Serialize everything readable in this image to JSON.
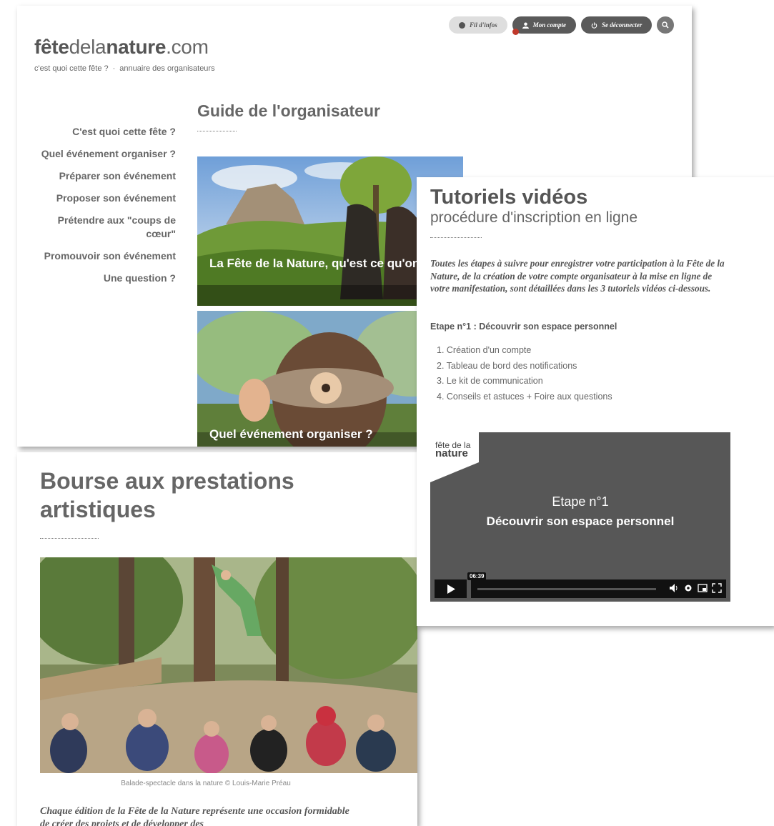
{
  "header": {
    "fil_infos": "Fil d'infos",
    "mon_compte": "Mon compte",
    "deconnecter": "Se déconnecter",
    "logo": {
      "a": "fête",
      "b": "dela",
      "c": "nature",
      "d": ".com"
    },
    "sublinks": [
      "c'est quoi cette fête ?",
      "annuaire des organisateurs"
    ],
    "separator": "·"
  },
  "sidebar": {
    "items": [
      "C'est quoi cette fête ?",
      "Quel événement organiser ?",
      "Préparer son événement",
      "Proposer son événement",
      "Prétendre aux \"coups de cœur\"",
      "Promouvoir son événement",
      "Une question ?"
    ]
  },
  "guide": {
    "title": "Guide de l'organisateur",
    "cards": [
      {
        "title": "La Fête de la Nature, qu'est ce qu'on c'est ?"
      },
      {
        "title": "Quel événement organiser ?"
      }
    ]
  },
  "tutoriels": {
    "title": "Tutoriels vidéos",
    "subtitle": "procédure d'inscription en ligne",
    "intro": "Toutes les étapes à suivre pour enregistrer votre participation à la Fête de la Nature, de la création de votre compte organisateur à la mise en ligne de votre manifestation, sont détaillées dans les 3 tutoriels vidéos ci-dessous.",
    "step": "Etape n°1 : Découvrir son espace personnel",
    "list": [
      "1. Création d'un compte",
      "2. Tableau de bord des notifications",
      "3. Le kit de communication",
      "4. Conseils et astuces + Foire aux questions"
    ],
    "video": {
      "logo_line1": "fête de la",
      "logo_line2": "nature",
      "title1": "Etape n°1",
      "title2": "Découvrir son espace personnel",
      "time": "06:39"
    }
  },
  "bourse": {
    "title": "Bourse aux prestations artistiques",
    "caption": "Balade-spectacle dans la nature © Louis-Marie Préau",
    "text": "Chaque édition de la Fête de la Nature représente une occasion formidable de créer des projets et de développer des"
  },
  "colors": {
    "dark_pill": "#5a5a5a",
    "badge": "#c0392b",
    "video_bg": "#575757"
  }
}
